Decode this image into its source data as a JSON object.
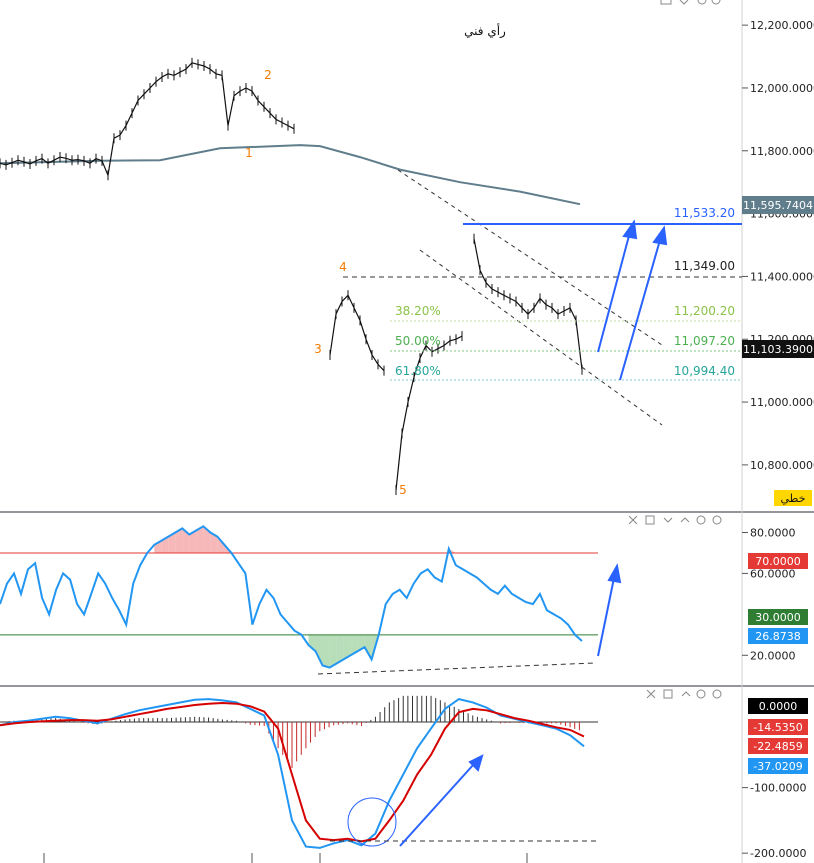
{
  "title": "رأي فني",
  "price_panel": {
    "y_ticks": [
      "12,200.0000",
      "12,000.0000",
      "11,800.0000",
      "11,600.0000",
      "11,400.0000",
      "11,200.0000",
      "11,000.0000",
      "10,800.0000"
    ],
    "ma_value": "11,595.7404",
    "last_price": "11,103.3900",
    "levels": [
      {
        "value": "11,533.20",
        "color": "#2962ff"
      },
      {
        "value": "11,349.00",
        "color": "#222222"
      },
      {
        "value": "11,200.20",
        "color": "#8bc34a"
      },
      {
        "value": "11,097.20",
        "color": "#4caf50"
      },
      {
        "value": "10,994.40",
        "color": "#26a69a"
      }
    ],
    "fib_labels": [
      "38.20%",
      "50.00%",
      "61.80%"
    ],
    "wave_labels": [
      "1",
      "2",
      "3",
      "4",
      "5"
    ],
    "mode_badge": "خطي",
    "chart_data": {
      "type": "line",
      "ylim": [
        10650,
        12280
      ],
      "close": [
        11760,
        11755,
        11762,
        11770,
        11765,
        11758,
        11768,
        11775,
        11760,
        11770,
        11780,
        11776,
        11770,
        11772,
        11768,
        11760,
        11775,
        11768,
        11722,
        11840,
        11850,
        11880,
        11920,
        11960,
        11980,
        12000,
        12020,
        12035,
        12045,
        12040,
        12050,
        12060,
        12080,
        12075,
        12070,
        12060,
        12045,
        12040,
        11880,
        11975,
        11990,
        12000,
        11990,
        11960,
        11940,
        11920,
        11900,
        11890,
        11880,
        11870,
        null,
        null,
        null,
        null,
        null,
        11150,
        11280,
        11320,
        11340,
        11300,
        11260,
        11200,
        11150,
        11120,
        11100,
        null,
        10720,
        10900,
        11000,
        11080,
        11140,
        11180,
        11160,
        11170,
        11180,
        11195,
        11200,
        11210,
        null,
        11520,
        11420,
        11380,
        11360,
        11350,
        11340,
        11330,
        11320,
        11300,
        11280,
        11300,
        11330,
        11310,
        11300,
        11280,
        11290,
        11300,
        11260,
        11103
      ],
      "moving_average": [
        [
          0,
          11760
        ],
        [
          100,
          11768
        ],
        [
          160,
          11770
        ],
        [
          220,
          11808
        ],
        [
          300,
          11818
        ],
        [
          320,
          11815
        ],
        [
          360,
          11780
        ],
        [
          400,
          11740
        ],
        [
          460,
          11700
        ],
        [
          520,
          11670
        ],
        [
          580,
          11630
        ]
      ],
      "wave_points": [
        [
          250,
          11812
        ],
        [
          265,
          12020
        ],
        [
          316,
          11130
        ],
        [
          340,
          11350
        ],
        [
          390,
          10600
        ]
      ]
    }
  },
  "rsi_panel": {
    "y_ticks": [
      "80.0000",
      "60.0000",
      "20.0000"
    ],
    "badges": [
      {
        "value": "70.0000",
        "color": "#e53935"
      },
      {
        "value": "30.0000",
        "color": "#2e7d32"
      },
      {
        "value": "26.8738",
        "color": "#2196f3"
      }
    ],
    "chart_data": {
      "type": "line",
      "ylim": [
        5,
        90
      ],
      "overbought": 70,
      "oversold": 30,
      "values": [
        45,
        55,
        60,
        50,
        62,
        65,
        48,
        40,
        52,
        60,
        57,
        45,
        40,
        50,
        60,
        55,
        48,
        42,
        35,
        55,
        64,
        70,
        74,
        76,
        78,
        80,
        82,
        79,
        81,
        83,
        80,
        78,
        74,
        70,
        65,
        60,
        35,
        45,
        52,
        48,
        40,
        36,
        32,
        30,
        25,
        22,
        15,
        14,
        16,
        18,
        20,
        22,
        24,
        18,
        30,
        45,
        50,
        52,
        48,
        55,
        60,
        62,
        58,
        56,
        72,
        64,
        62,
        60,
        58,
        55,
        52,
        50,
        54,
        50,
        48,
        46,
        45,
        50,
        42,
        40,
        38,
        35,
        30,
        27
      ]
    }
  },
  "macd_panel": {
    "y_ticks": [
      "-100.0000",
      "-200.0000"
    ],
    "badges": [
      {
        "value": "0.0000",
        "color": "#000000"
      },
      {
        "value": "-14.5350",
        "color": "#e53935"
      },
      {
        "value": "-22.4859",
        "color": "#e53935"
      },
      {
        "value": "-37.0209",
        "color": "#2196f3"
      }
    ],
    "chart_data": {
      "type": "line",
      "ylim": [
        -215,
        55
      ],
      "series": [
        {
          "color": "#2196f3",
          "values": [
            -5,
            0,
            2,
            5,
            8,
            6,
            2,
            -2,
            5,
            12,
            18,
            22,
            26,
            30,
            34,
            35,
            33,
            30,
            20,
            10,
            -50,
            -150,
            -190,
            -192,
            -185,
            -180,
            -188,
            -170,
            -120,
            -80,
            -40,
            -10,
            20,
            35,
            30,
            22,
            10,
            5,
            0,
            -5,
            -10,
            -20,
            -37
          ]
        },
        {
          "color": "#d50000",
          "values": [
            -5,
            -2,
            0,
            1,
            2,
            3,
            3,
            2,
            4,
            8,
            12,
            16,
            20,
            23,
            26,
            28,
            29,
            28,
            24,
            16,
            -10,
            -80,
            -150,
            -178,
            -180,
            -178,
            -182,
            -178,
            -150,
            -120,
            -80,
            -50,
            -10,
            15,
            20,
            18,
            12,
            6,
            2,
            -3,
            -8,
            -12,
            -22
          ]
        },
        {
          "color": "#111111",
          "values": [
            0,
            2,
            2,
            4,
            6,
            3,
            -1,
            -4,
            1,
            4,
            6,
            6,
            6,
            7,
            8,
            7,
            4,
            2,
            -4,
            -6,
            -40,
            -70,
            -40,
            -14,
            -5,
            -2,
            -6,
            8,
            30,
            40,
            40,
            40,
            30,
            20,
            10,
            4,
            -2,
            -1,
            -2,
            -2,
            -2,
            -8,
            -15
          ]
        }
      ]
    }
  },
  "icons": [
    "close-icon",
    "maximize-icon",
    "chevron-down-icon",
    "chevron-up-icon",
    "settings-icon",
    "more-icon"
  ]
}
